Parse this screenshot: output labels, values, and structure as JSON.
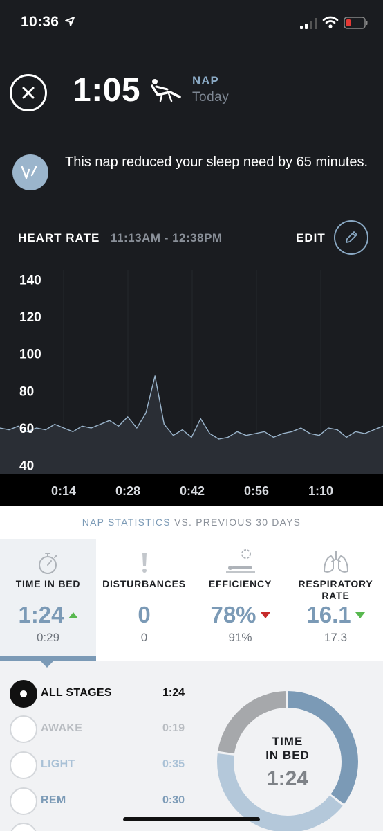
{
  "status_bar": {
    "time": "10:36"
  },
  "header": {
    "duration": "1:05",
    "type_label": "NAP",
    "day_label": "Today"
  },
  "insight": {
    "text": "This nap reduced your sleep need by 65 minutes."
  },
  "heart_rate": {
    "title": "HEART RATE",
    "range": "11:13AM - 12:38PM",
    "edit_label": "EDIT"
  },
  "chart_data": {
    "type": "area",
    "title": "HEART RATE",
    "xlabel": "",
    "ylabel": "",
    "x_ticks": [
      "0:14",
      "0:28",
      "0:42",
      "0:56",
      "1:10"
    ],
    "y_ticks": [
      140,
      120,
      100,
      80,
      60,
      40
    ],
    "ylim": [
      35,
      145
    ],
    "x_minutes": [
      0,
      2,
      4,
      6,
      8,
      10,
      12,
      14,
      16,
      18,
      20,
      22,
      24,
      26,
      28,
      30,
      32,
      34,
      35,
      36,
      38,
      40,
      42,
      44,
      46,
      48,
      50,
      52,
      54,
      56,
      58,
      60,
      62,
      64,
      66,
      68,
      70,
      72,
      74,
      76,
      78,
      80,
      82,
      84
    ],
    "series": [
      {
        "values": [
          60,
          59,
          61,
          58,
          60,
          59,
          62,
          60,
          58,
          61,
          60,
          62,
          64,
          61,
          66,
          60,
          68,
          88,
          75,
          62,
          56,
          59,
          55,
          65,
          57,
          54,
          55,
          58,
          56,
          57,
          58,
          55,
          57,
          58,
          60,
          57,
          56,
          60,
          59,
          55,
          58,
          57,
          59,
          61
        ]
      }
    ]
  },
  "stats": {
    "caption_accent": "NAP STATISTICS",
    "caption_rest": "VS. PREVIOUS 30 DAYS",
    "items": [
      {
        "label": "TIME IN BED",
        "value": "1:24",
        "prev": "0:29",
        "trend": "up"
      },
      {
        "label": "DISTURBANCES",
        "value": "0",
        "prev": "0",
        "trend": "none"
      },
      {
        "label": "EFFICIENCY",
        "value": "78%",
        "prev": "91%",
        "trend": "down-bad"
      },
      {
        "label": "RESPIRATORY RATE",
        "value": "16.1",
        "prev": "17.3",
        "trend": "down-good"
      }
    ]
  },
  "stages": {
    "items": [
      {
        "name": "ALL STAGES",
        "value": "1:24",
        "name_color": "#111111",
        "value_color": "#111111"
      },
      {
        "name": "AWAKE",
        "value": "0:19",
        "name_color": "#b8bcc1",
        "value_color": "#b8bcc1"
      },
      {
        "name": "LIGHT",
        "value": "0:35",
        "name_color": "#a9c1d6",
        "value_color": "#a9c1d6"
      },
      {
        "name": "REM",
        "value": "0:30",
        "name_color": "#7b9ab6",
        "value_color": "#7b9ab6"
      }
    ],
    "donut_label": "TIME IN BED",
    "donut_value": "1:24",
    "donut_segments": [
      {
        "stage": "REM",
        "minutes": 30,
        "color": "#7b9ab6"
      },
      {
        "stage": "LIGHT",
        "minutes": 35,
        "color": "#b4c8da"
      },
      {
        "stage": "AWAKE",
        "minutes": 19,
        "color": "#a6a8ab"
      }
    ]
  },
  "colors": {
    "accent": "#7b9ab6",
    "background": "#1a1c20",
    "up": "#58b84f",
    "down_bad": "#c62a2a"
  }
}
